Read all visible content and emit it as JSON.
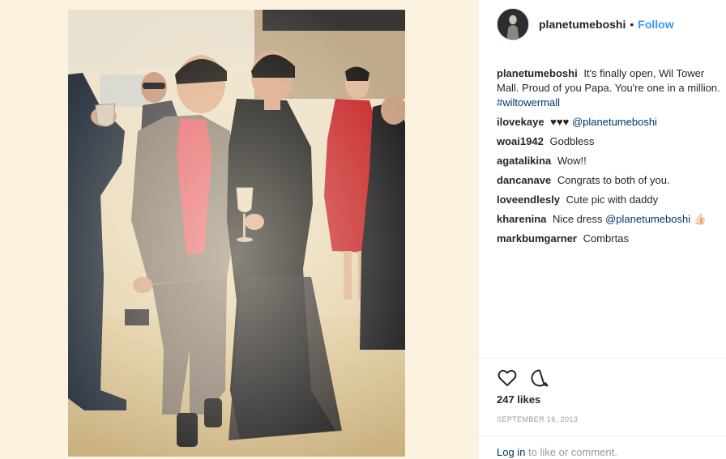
{
  "post": {
    "username": "planetumeboshi",
    "separator": "•",
    "follow_label": "Follow",
    "caption_text": "It's finally open, Wil Tower Mall. Proud of you Papa. You're one in a million.",
    "caption_hashtag": "#wiltowermall"
  },
  "comments": [
    {
      "user": "ilovekaye",
      "text": "♥♥♥",
      "mention": "@planetumeboshi",
      "suffix": ""
    },
    {
      "user": "woai1942",
      "text": "Godbless",
      "mention": "",
      "suffix": ""
    },
    {
      "user": "agatalikina",
      "text": "Wow!!",
      "mention": "",
      "suffix": ""
    },
    {
      "user": "dancanave",
      "text": "Congrats to both of you.",
      "mention": "",
      "suffix": ""
    },
    {
      "user": "loveendlesly",
      "text": "Cute pic with daddy",
      "mention": "",
      "suffix": ""
    },
    {
      "user": "kharenina",
      "text": "Nice dress",
      "mention": "@planetumeboshi",
      "suffix": "👍🏻"
    },
    {
      "user": "markbumgarner",
      "text": "Combrtas",
      "mention": "",
      "suffix": ""
    }
  ],
  "stats": {
    "likes": "247 likes",
    "date": "SEPTEMBER 16, 2013"
  },
  "footer": {
    "login_link": "Log in",
    "login_rest": " to like or comment."
  },
  "icons": {
    "like": "heart-outline-icon",
    "comment": "speech-bubble-icon"
  },
  "colors": {
    "link_blue": "#3897f0",
    "mention_blue": "#003569",
    "muted": "#999999"
  }
}
